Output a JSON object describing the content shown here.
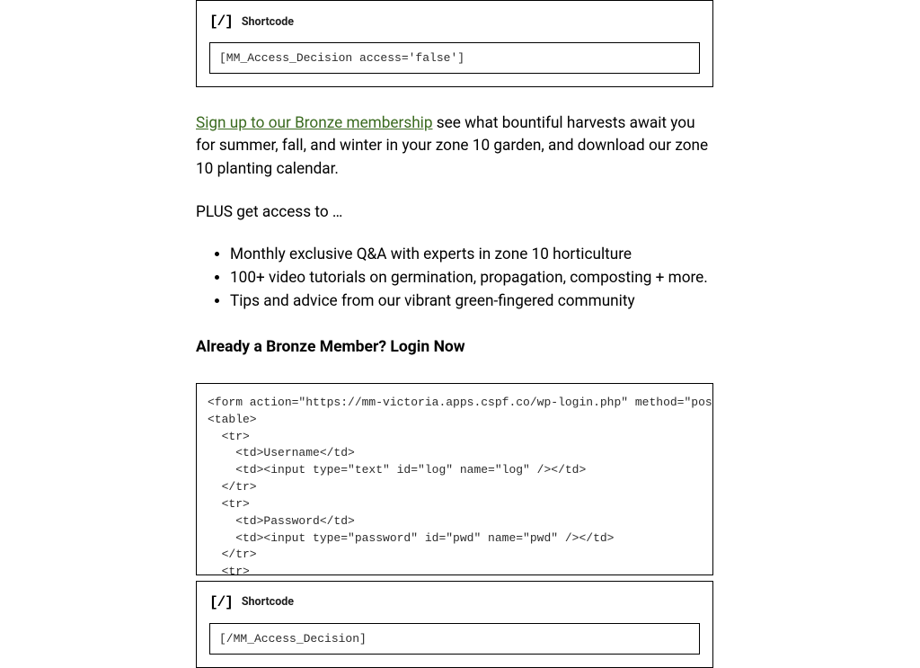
{
  "shortcode_block_1": {
    "icon": "[/]",
    "label": "Shortcode",
    "value": "[MM_Access_Decision access='false']"
  },
  "paragraph_1": {
    "link_text": "Sign up to our Bronze membership",
    "rest": " see what bountiful harvests await you for summer, fall, and winter in your zone 10 garden, and download our zone 10 planting calendar."
  },
  "paragraph_2": "PLUS get access to …",
  "bullets": [
    "Monthly exclusive Q&A with experts in zone 10 horticulture",
    "100+ video tutorials on germination, propagation, composting + more.",
    "Tips and advice from our vibrant green-fingered community"
  ],
  "sub_heading": "Already a Bronze Member? Login Now",
  "code_block": "<form action=\"https://mm-victoria.apps.cspf.co/wp-login.php\" method=\"post\">\n<table>\n  <tr>\n    <td>Username</td>\n    <td><input type=\"text\" id=\"log\" name=\"log\" /></td>\n  </tr>\n  <tr>\n    <td>Password</td>\n    <td><input type=\"password\" id=\"pwd\" name=\"pwd\" /></td>\n  </tr>\n  <tr>",
  "shortcode_block_2": {
    "icon": "[/]",
    "label": "Shortcode",
    "value": "[/MM_Access_Decision]"
  }
}
